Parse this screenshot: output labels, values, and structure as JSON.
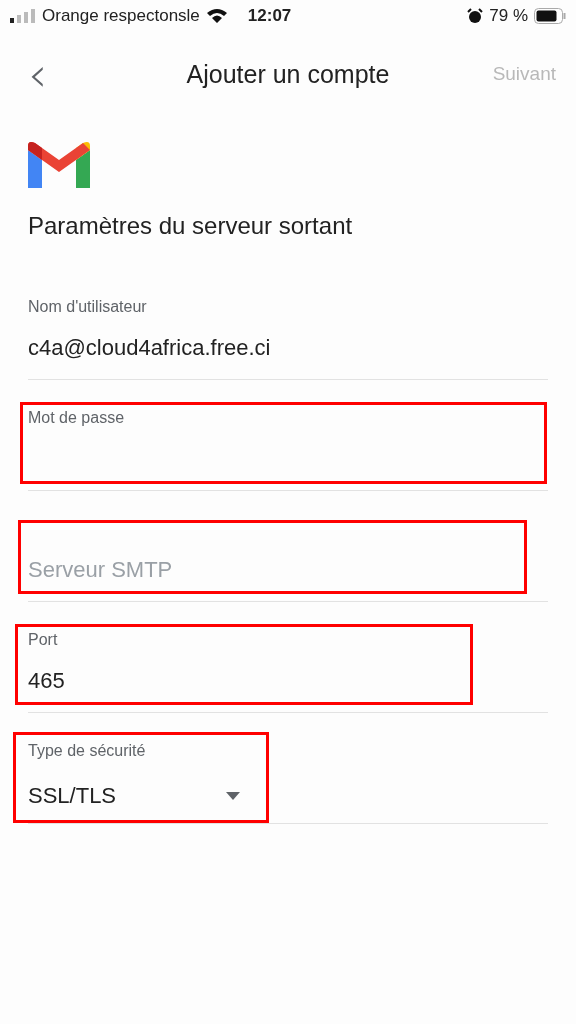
{
  "status_bar": {
    "carrier": "Orange respectonsle",
    "time": "12:07",
    "battery": "79 %"
  },
  "nav": {
    "back": "‹",
    "title": "Ajouter un compte",
    "next": {
      "label": "Suivant",
      "disabled": true
    }
  },
  "heading": "Paramètres du serveur sortant",
  "fields": [
    {
      "kind": "text",
      "label": "Nom d'utilisateur",
      "value": "c4a@cloud4africa.free.ci",
      "highlighted": false
    },
    {
      "kind": "text",
      "label": "Mot de passe",
      "highlighted": true
    },
    {
      "kind": "text",
      "placeholder": "Serveur SMTP",
      "highlighted": true
    },
    {
      "kind": "text",
      "label": "Port",
      "value": "465",
      "highlighted": true
    },
    {
      "kind": "dropdown",
      "label": "Type de sécurité",
      "value": "SSL/TLS",
      "highlighted": true
    }
  ]
}
